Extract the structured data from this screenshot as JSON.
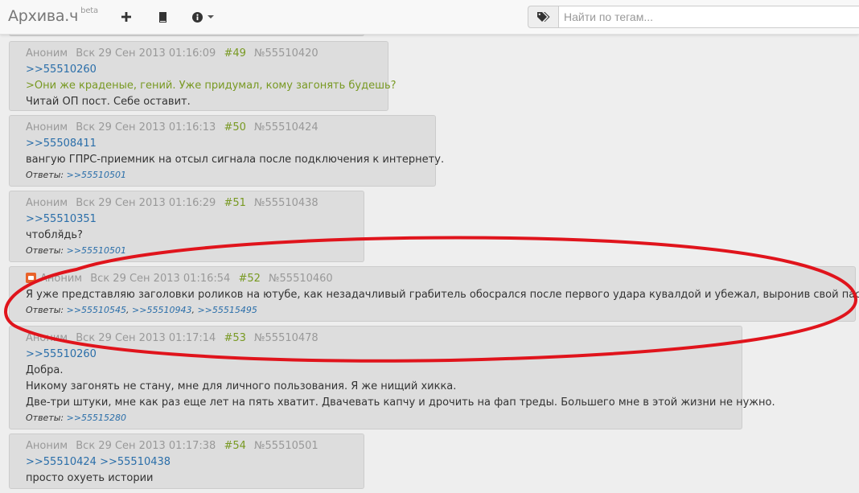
{
  "navbar": {
    "brand": "Архива.ч",
    "brand_sup": "beta",
    "search_placeholder": "Найти по тегам..."
  },
  "posts": [
    {
      "author": "Аноним",
      "date": "Вск 29 Сен 2013 01:16:09",
      "num": "#49",
      "id": "№55510420",
      "lines": [
        {
          "type": "link",
          "text": ">>55510260"
        },
        {
          "type": "green",
          "text": ">Они же краденые, гений. Уже придумал, кому загонять будешь?"
        },
        {
          "type": "text",
          "text": "Читай ОП пост. Себе оставит."
        }
      ]
    },
    {
      "author": "Аноним",
      "date": "Вск 29 Сен 2013 01:16:13",
      "num": "#50",
      "id": "№55510424",
      "lines": [
        {
          "type": "link",
          "text": ">>55508411"
        },
        {
          "type": "text",
          "text": "вангую ГПРС-приемник на отсыл сигнала после подключения к интернету."
        }
      ],
      "answers_label": "Ответы:",
      "answers": [
        ">>55510501"
      ]
    },
    {
      "author": "Аноним",
      "date": "Вск 29 Сен 2013 01:16:29",
      "num": "#51",
      "id": "№55510438",
      "lines": [
        {
          "type": "link",
          "text": ">>55510351"
        },
        {
          "type": "text",
          "text": "чтобля̆дь?"
        }
      ],
      "answers_label": "Ответы:",
      "answers": [
        ">>55510501"
      ]
    },
    {
      "author": "Аноним",
      "date": "Вск 29 Сен 2013 01:16:54",
      "num": "#52",
      "id": "№55510460",
      "lines": [
        {
          "type": "text",
          "text": "Я уже представляю заголовки роликов на ютубе, как незадачливый грабитель обосрался после первого удара кувалдой и убежал, выронив свой паспорт."
        }
      ],
      "answers_label": "Ответы:",
      "answers": [
        ">>55510545",
        ">>55510943",
        ">>55515495"
      ]
    },
    {
      "author": "Аноним",
      "date": "Вск 29 Сен 2013 01:17:14",
      "num": "#53",
      "id": "№55510478",
      "lines": [
        {
          "type": "link",
          "text": ">>55510260"
        },
        {
          "type": "text",
          "text": "Добра."
        },
        {
          "type": "text",
          "text": "Никому загонять не стану, мне для личного пользования. Я же нищий хикка."
        },
        {
          "type": "text",
          "text": "Две-три штуки, мне как раз еще лет на пять хватит. Двачевать капчу и дрочить на фап треды. Большего мне в этой жизни не нужно."
        }
      ],
      "answers_label": "Ответы:",
      "answers": [
        ">>55515280"
      ]
    },
    {
      "author": "Аноним",
      "date": "Вск 29 Сен 2013 01:17:38",
      "num": "#54",
      "id": "№55510501",
      "lines": [
        {
          "type": "links",
          "items": [
            ">>55510424",
            ">>55510438"
          ]
        },
        {
          "type": "text",
          "text": "просто охуеть истории"
        }
      ]
    }
  ],
  "colors": {
    "link": "#2a6ea9",
    "green": "#789922",
    "post_bg": "#dddddd",
    "page_bg": "#eeeeee",
    "circle": "#e0141c"
  }
}
